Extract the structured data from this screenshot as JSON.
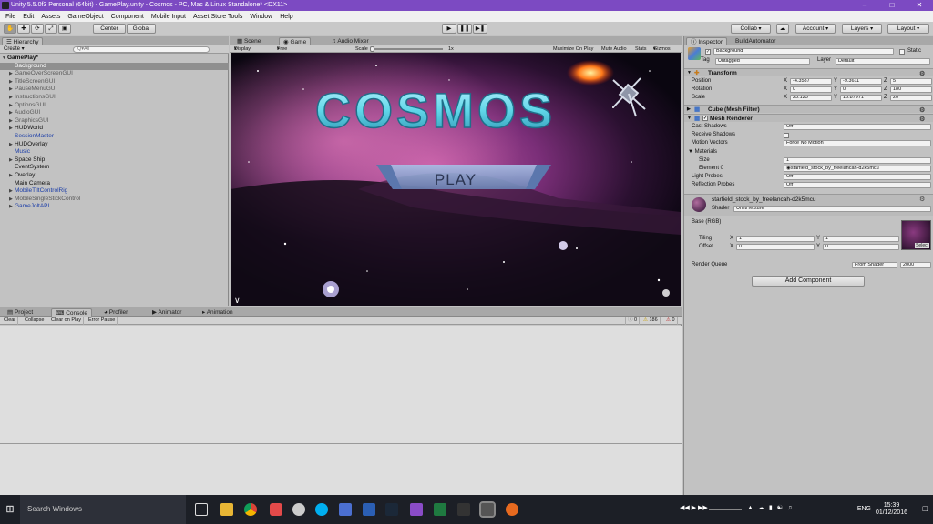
{
  "titlebar": {
    "title": "Unity 5.5.0f3 Personal (64bit) - GamePlay.unity - Cosmos - PC, Mac & Linux Standalone* <DX11>"
  },
  "menu": [
    "File",
    "Edit",
    "Assets",
    "GameObject",
    "Component",
    "Mobile Input",
    "Asset Store Tools",
    "Window",
    "Help"
  ],
  "toolbar": {
    "center": "Center",
    "global": "Global",
    "collab": "Collab",
    "account": "Account",
    "layers": "Layers",
    "layout": "Layout"
  },
  "hierarchy": {
    "tab": "Hierarchy",
    "create": "Create",
    "search_placeholder": "Q▾All",
    "scene": "GamePlay*",
    "items": [
      {
        "label": "Background",
        "style": "sel",
        "arrow": false
      },
      {
        "label": "GameOverScreenGUI",
        "style": "gray",
        "arrow": true
      },
      {
        "label": "TitleScreenGUI",
        "style": "gray",
        "arrow": true
      },
      {
        "label": "PauseMenuGUI",
        "style": "gray",
        "arrow": true
      },
      {
        "label": "InstructionsGUI",
        "style": "gray",
        "arrow": true
      },
      {
        "label": "OptionsGUI",
        "style": "gray",
        "arrow": true
      },
      {
        "label": "AudioGUI",
        "style": "gray",
        "arrow": true
      },
      {
        "label": "GraphicsGUI",
        "style": "gray",
        "arrow": true
      },
      {
        "label": "HUDWorld",
        "style": "normal",
        "arrow": true
      },
      {
        "label": "SessionMaster",
        "style": "blue",
        "arrow": false
      },
      {
        "label": "HUDOverlay",
        "style": "normal",
        "arrow": true
      },
      {
        "label": "Music",
        "style": "blue",
        "arrow": false
      },
      {
        "label": "Space Ship",
        "style": "normal",
        "arrow": true
      },
      {
        "label": "EventSystem",
        "style": "normal",
        "arrow": false
      },
      {
        "label": "Overlay",
        "style": "normal",
        "arrow": true
      },
      {
        "label": "Main Camera",
        "style": "normal",
        "arrow": false
      },
      {
        "label": "MobileTiltControlRig",
        "style": "blue",
        "arrow": true
      },
      {
        "label": "MobileSingleStickControl",
        "style": "gray",
        "arrow": true
      },
      {
        "label": "GameJoltAPI",
        "style": "blue",
        "arrow": true
      }
    ]
  },
  "game": {
    "tabs": [
      "Scene",
      "Game",
      "Audio Mixer"
    ],
    "display": "Display 1",
    "aspect": "Free Aspect",
    "scale_label": "Scale",
    "scale_value": "1x",
    "toggles": [
      "Maximize On Play",
      "Mute Audio",
      "Stats",
      "Gizmos"
    ],
    "title_text": "COSMOS",
    "play_text": "PLAY"
  },
  "bottom": {
    "tabs": [
      "Project",
      "Console",
      "Profiler",
      "Animator",
      "Animation"
    ],
    "buttons": [
      "Clear",
      "Collapse",
      "Clear on Play",
      "Error Pause"
    ],
    "counts": {
      "info": "0",
      "warn": "186",
      "err": "0"
    }
  },
  "inspector": {
    "tabs": [
      "Inspector",
      "BuildAutomator"
    ],
    "object_name": "Background",
    "static": "Static",
    "tag_label": "Tag",
    "tag": "Untagged",
    "layer_label": "Layer",
    "layer": "Default",
    "transform": {
      "title": "Transform",
      "position": {
        "label": "Position",
        "x": "-4.3587",
        "y": "-9.3611",
        "z": "5"
      },
      "rotation": {
        "label": "Rotation",
        "x": "0",
        "y": "0",
        "z": "180"
      },
      "scale": {
        "label": "Scale",
        "x": "25.125",
        "y": "16.87971",
        "z": "20"
      }
    },
    "mesh_filter": "Cube (Mesh Filter)",
    "mesh_renderer": {
      "title": "Mesh Renderer",
      "cast_shadows": {
        "label": "Cast Shadows",
        "value": "Off"
      },
      "receive_shadows": {
        "label": "Receive Shadows"
      },
      "motion_vectors": {
        "label": "Motion Vectors",
        "value": "Force No Motion"
      },
      "materials": "Materials",
      "size": {
        "label": "Size",
        "value": "1"
      },
      "element0": {
        "label": "Element 0",
        "value": "starfield_stock_by_freelancah-d2k5mcu"
      },
      "light_probes": {
        "label": "Light Probes",
        "value": "Off"
      },
      "reflection_probes": {
        "label": "Reflection Probes",
        "value": "Off"
      }
    },
    "material": {
      "name": "starfield_stock_by_freelancah-d2k5mcu",
      "shader_label": "Shader",
      "shader": "Unlit/Texture",
      "base": "Base (RGB)",
      "tiling": {
        "label": "Tiling",
        "x": "1",
        "y": "1"
      },
      "offset": {
        "label": "Offset",
        "x": "0",
        "y": "0"
      },
      "select": "Select",
      "render_queue": {
        "label": "Render Queue",
        "mode": "From Shader",
        "value": "2000"
      }
    },
    "add_component": "Add Component"
  },
  "taskbar": {
    "search": "Search Windows",
    "lang": "ENG",
    "time": "15:39",
    "date": "01/12/2016"
  }
}
